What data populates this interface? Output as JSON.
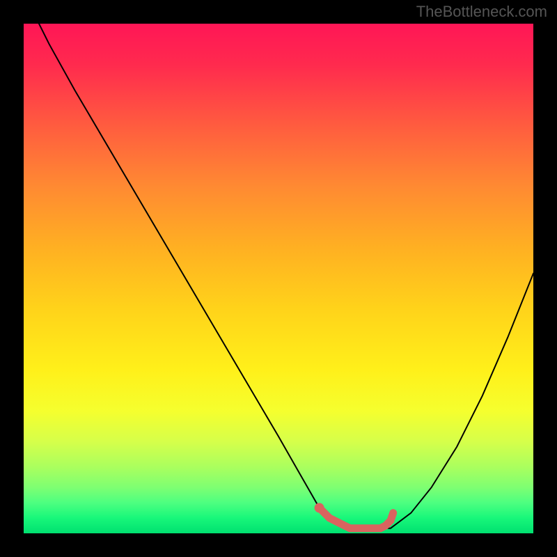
{
  "attribution": "TheBottleneck.com",
  "chart_data": {
    "type": "line",
    "title": "",
    "xlabel": "",
    "ylabel": "",
    "xlim": [
      0,
      100
    ],
    "ylim": [
      0,
      100
    ],
    "series": [
      {
        "name": "curve",
        "x": [
          3,
          5,
          10,
          20,
          30,
          40,
          50,
          54,
          58,
          60,
          64,
          68,
          70,
          72,
          76,
          80,
          85,
          90,
          95,
          100
        ],
        "y": [
          100,
          96,
          87,
          70,
          53,
          36,
          19,
          12,
          5,
          3,
          1,
          1,
          1,
          1,
          4,
          9,
          17,
          27,
          38.5,
          51
        ]
      },
      {
        "name": "highlight",
        "x": [
          58,
          60,
          62,
          64,
          66,
          68,
          70,
          71,
          72,
          72.5
        ],
        "y": [
          5,
          3,
          2,
          1,
          1,
          1,
          1,
          1.5,
          2.5,
          4
        ]
      }
    ],
    "highlight_color": "#d9645f",
    "curve_color": "#000000"
  }
}
